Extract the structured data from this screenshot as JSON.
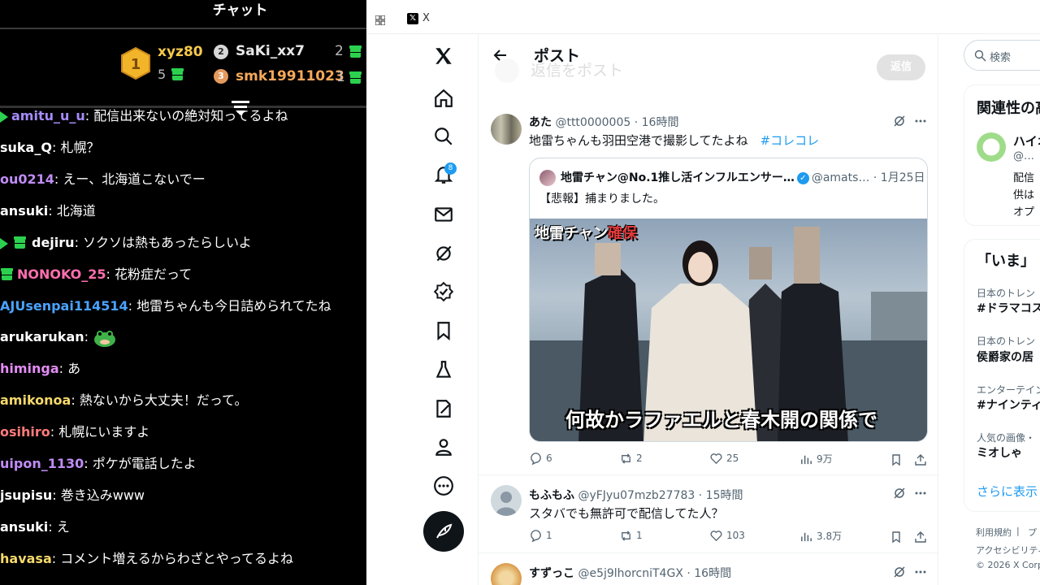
{
  "chat": {
    "title": "チャット",
    "leaderboard": [
      {
        "rank": "1",
        "name": "xyz80",
        "count": "5"
      },
      {
        "rank": "2",
        "name": "SaKi_xx7",
        "count": "2"
      },
      {
        "rank": "3",
        "name": "smk19911023",
        "count": "1"
      }
    ],
    "messages": [
      {
        "user": "amitu_u_u",
        "text": "配信出来ないの絶対知ってるよね",
        "color": "#a78bfa"
      },
      {
        "user": "suka_Q",
        "text": "札幌？",
        "color": "#ffffff"
      },
      {
        "user": "ou0214",
        "text": "えー、北海道こないでー",
        "color": "#c08cf5"
      },
      {
        "user": "ansuki",
        "text": "北海道",
        "color": "#ffffff"
      },
      {
        "user": "dejiru",
        "text": "ソクソは熱もあったらしいよ",
        "color": "#ffffff"
      },
      {
        "user": "NONOKO_25",
        "text": "花粉症だって",
        "color": "#ff6fae"
      },
      {
        "user": "AJUsenpai114514",
        "text": "地雷ちゃんも今日詰められてたね",
        "color": "#4aa3ff"
      },
      {
        "user": "arukarukan",
        "text": "",
        "color": "#ffffff"
      },
      {
        "user": "himinga",
        "text": "あ",
        "color": "#e48cf5"
      },
      {
        "user": "amikonoa",
        "text": "熱ないから大丈夫！だって。",
        "color": "#f5d96b"
      },
      {
        "user": "osihiro",
        "text": "札幌にいますよ",
        "color": "#ff7b7b"
      },
      {
        "user": "uipon_1130",
        "text": "ポケが電話したよ",
        "color": "#c08cf5"
      },
      {
        "user": "jsupisu",
        "text": "巻き込みwww",
        "color": "#ffffff"
      },
      {
        "user": "ansuki",
        "text": "え",
        "color": "#ffffff"
      },
      {
        "user": "havasa",
        "text": "コメント増えるからわざとやってるよね",
        "color": "#f5d96b"
      }
    ]
  },
  "browser": {
    "tab_label": "X"
  },
  "x": {
    "header_title": "ポスト",
    "reply_placeholder": "返信をポスト",
    "reply_button": "返信",
    "notif_count": "8",
    "tweets": [
      {
        "display_name": "あた",
        "handle": "@ttt0000005",
        "time": "16時間",
        "text": "地雷ちゃんも羽田空港で撮影してたよね",
        "hashtag": "#コレコレ",
        "quote": {
          "display_name": "地雷チャン@No.1推し活インフルエンサー…",
          "handle": "@amats…",
          "time": "1月25日",
          "text": "【悲報】捕まりました。",
          "media_title_prefix": "地雷チャン",
          "media_title_red": "確保",
          "media_caption": "何故かラファエルと春木開の関係で"
        },
        "replies": "6",
        "reposts": "2",
        "likes": "25",
        "views": "9万"
      },
      {
        "display_name": "もふもふ",
        "handle": "@yFJyu07mzb27783",
        "time": "15時間",
        "text": "スタバでも無許可で配信してた人？",
        "replies": "1",
        "reposts": "1",
        "likes": "103",
        "views": "3.8万"
      },
      {
        "display_name": "すずっこ",
        "handle": "@e5j9lhorcniT4GX",
        "time": "16時間"
      }
    ]
  },
  "sidebar_right": {
    "search_placeholder": "検索",
    "relevant_title": "関連性の高",
    "relevant_user": "ハイオ",
    "relevant_handle": "@…",
    "relevant_bio_1": "配信",
    "relevant_bio_2": "供は",
    "relevant_bio_3": "オプ",
    "now_title": "「いま」",
    "trends": [
      {
        "category": "日本のトレン",
        "name": "#ドラマコス"
      },
      {
        "category": "日本のトレン",
        "name": "侯爵家の居"
      },
      {
        "category": "エンターテイン",
        "name": "#ナインティ"
      },
      {
        "category": "人気の画像・",
        "name": "ミオしゃ"
      }
    ],
    "show_more": "さらに表示",
    "footer_terms": "利用規約",
    "footer_sep": "|",
    "footer_privacy": "プ",
    "footer_access": "アクセシビリティ",
    "footer_copyright": "© 2026 X Corp."
  }
}
